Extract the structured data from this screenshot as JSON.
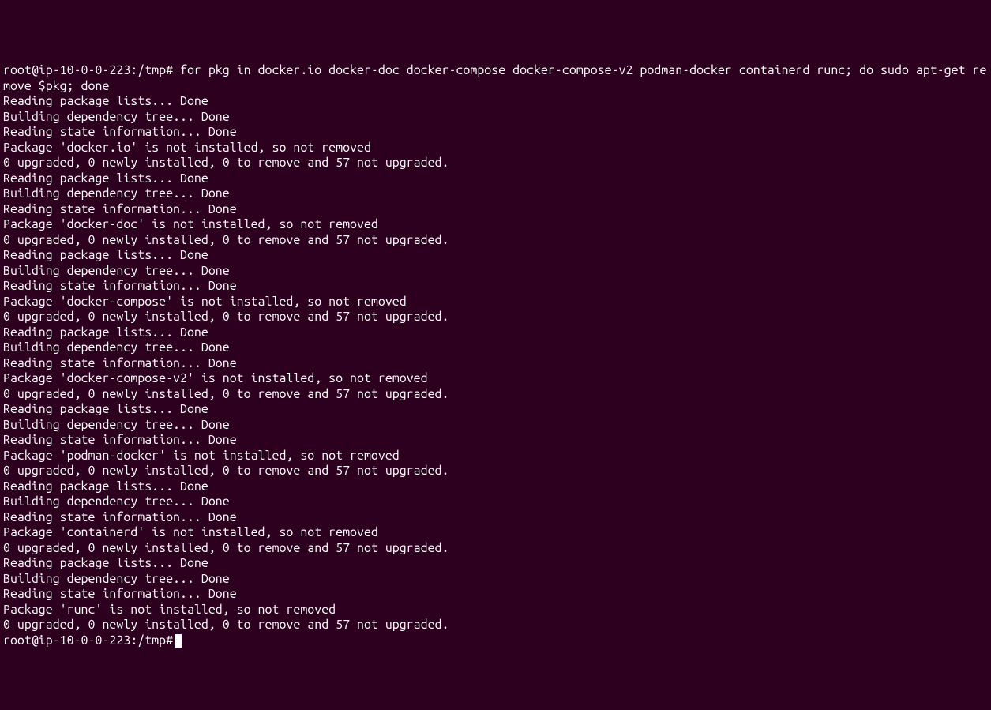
{
  "terminal": {
    "prompt": "root@ip-10-0-0-223:/tmp#",
    "command": "for pkg in docker.io docker-doc docker-compose docker-compose-v2 podman-docker containerd runc; do sudo apt-get remove $pkg; done",
    "packages": [
      "docker.io",
      "docker-doc",
      "docker-compose",
      "docker-compose-v2",
      "podman-docker",
      "containerd",
      "runc"
    ],
    "block": {
      "line1": "Reading package lists... Done",
      "line2": "Building dependency tree... Done",
      "line3": "Reading state information... Done",
      "line5": "0 upgraded, 0 newly installed, 0 to remove and 57 not upgraded."
    },
    "not_installed": {
      "p0": "Package 'docker.io' is not installed, so not removed",
      "p1": "Package 'docker-doc' is not installed, so not removed",
      "p2": "Package 'docker-compose' is not installed, so not removed",
      "p3": "Package 'docker-compose-v2' is not installed, so not removed",
      "p4": "Package 'podman-docker' is not installed, so not removed",
      "p5": "Package 'containerd' is not installed, so not removed",
      "p6": "Package 'runc' is not installed, so not removed"
    }
  }
}
